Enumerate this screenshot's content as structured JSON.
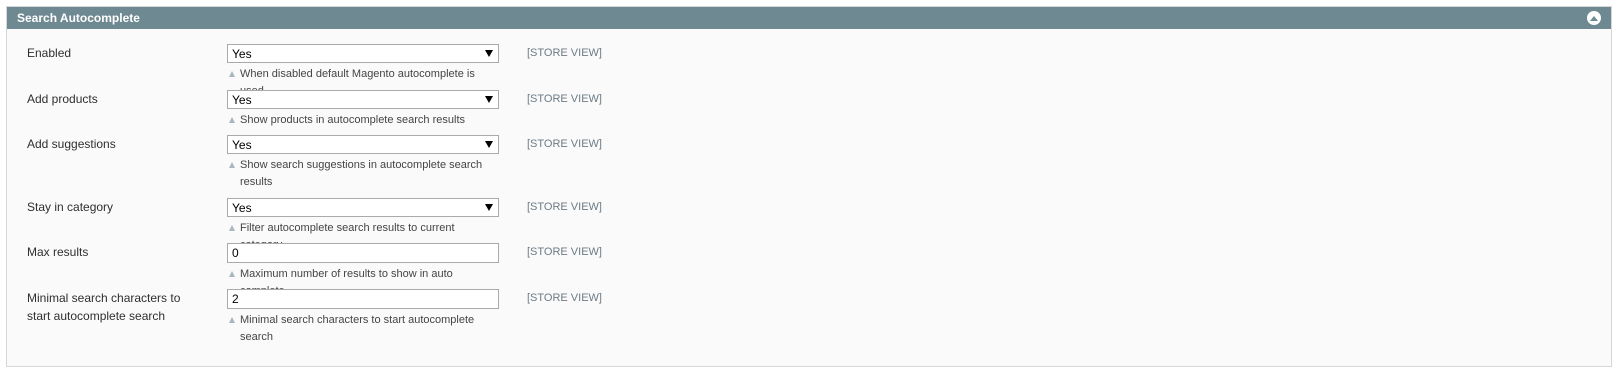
{
  "section": {
    "title": "Search Autocomplete",
    "collapse_icon": "chevron-up-circle-icon"
  },
  "fields": [
    {
      "label": "Enabled",
      "type": "select",
      "value": "Yes",
      "note": "When disabled default Magento autocomplete is used",
      "scope": "[STORE VIEW]"
    },
    {
      "label": "Add products",
      "type": "select",
      "value": "Yes",
      "note": "Show products in autocomplete search results",
      "scope": "[STORE VIEW]"
    },
    {
      "label": "Add suggestions",
      "type": "select",
      "value": "Yes",
      "note": "Show search suggestions in autocomplete search results",
      "scope": "[STORE VIEW]"
    },
    {
      "label": "Stay in category",
      "type": "select",
      "value": "Yes",
      "note": "Filter autocomplete search results to current category",
      "scope": "[STORE VIEW]"
    },
    {
      "label": "Max results",
      "type": "text",
      "value": "0",
      "note": "Maximum number of results to show in auto complete.",
      "scope": "[STORE VIEW]"
    },
    {
      "label": "Minimal search characters to start autocomplete search",
      "type": "text",
      "value": "2",
      "note": "Minimal search characters to start autocomplete search",
      "scope": "[STORE VIEW]"
    }
  ],
  "colors": {
    "header_bg": "#6f8992",
    "panel_bg": "#fafafa",
    "scope_text": "#6d7b85"
  }
}
